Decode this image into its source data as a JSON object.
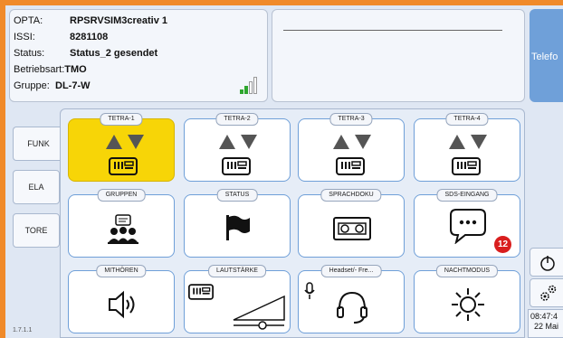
{
  "info": {
    "opta_label": "OPTA:",
    "opta_value": "RPSRVSIM3creativ   1",
    "issi_label": "ISSI:",
    "issi_value": "8281108",
    "status_label": "Status:",
    "status_value": "Status_2 gesendet",
    "betriebsart_label": "Betriebsart:",
    "betriebsart_value": "TMO",
    "gruppe_label": "Gruppe:",
    "gruppe_value": "DL-7-W"
  },
  "telefon_label": "Telefo",
  "side_tabs": [
    "FUNK",
    "ELA",
    "TORE"
  ],
  "tiles": {
    "tetra1": "TETRA-1",
    "tetra2": "TETRA-2",
    "tetra3": "TETRA-3",
    "tetra4": "TETRA-4",
    "gruppen": "GRUPPEN",
    "status": "STATUS",
    "sprachdoku": "SPRACHDOKU",
    "sds": "SDS-EINGANG",
    "mithoeren": "MITHÖREN",
    "lautstaerke": "LAUTSTÄRKE",
    "headset": "Headset/- Fre...",
    "nachtmodus": "NACHTMODUS"
  },
  "sds_badge": "12",
  "clock": {
    "time": "08:47:4",
    "date": "22 Mai"
  },
  "version": "1.7.1.1",
  "colors": {
    "accent_orange": "#f08a2a",
    "active_tile": "#f7d507",
    "badge": "#d91e1e",
    "tile_border": "#6f9fd8"
  }
}
